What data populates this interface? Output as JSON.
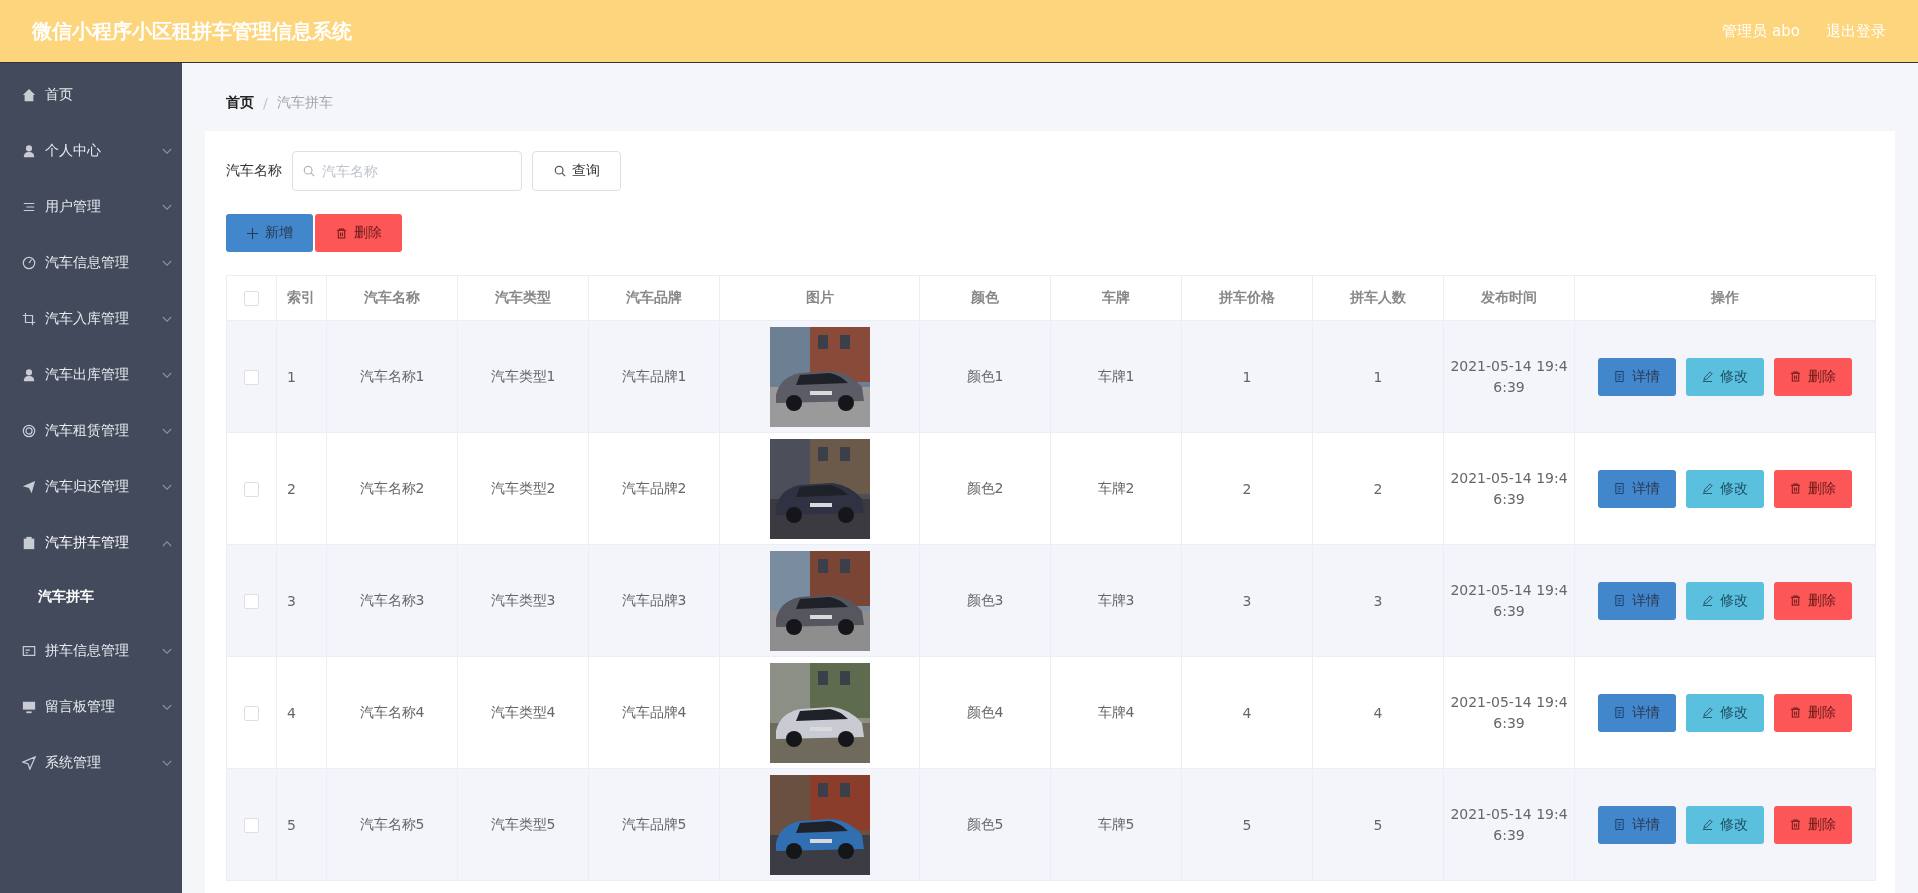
{
  "header": {
    "title": "微信小程序小区租拼车管理信息系统",
    "user": "管理员 abo",
    "logout": "退出登录"
  },
  "sidebar": {
    "items": [
      {
        "label": "首页"
      },
      {
        "label": "个人中心",
        "expanded": false
      },
      {
        "label": "用户管理",
        "expanded": false
      },
      {
        "label": "汽车信息管理",
        "expanded": false
      },
      {
        "label": "汽车入库管理",
        "expanded": false
      },
      {
        "label": "汽车出库管理",
        "expanded": false
      },
      {
        "label": "汽车租赁管理",
        "expanded": false
      },
      {
        "label": "汽车归还管理",
        "expanded": false
      },
      {
        "label": "汽车拼车管理",
        "expanded": true,
        "children": [
          {
            "label": "汽车拼车",
            "selected": true
          }
        ]
      },
      {
        "label": "拼车信息管理",
        "expanded": false
      },
      {
        "label": "留言板管理",
        "expanded": false
      },
      {
        "label": "系统管理",
        "expanded": false
      }
    ]
  },
  "breadcrumb": [
    {
      "label": "首页",
      "current": false
    },
    {
      "label": "汽车拼车",
      "current": true
    }
  ],
  "breadcrumb_separator": "/",
  "search": {
    "label": "汽车名称",
    "placeholder": "汽车名称",
    "button": "查询"
  },
  "toolbar": [
    {
      "label": "新增",
      "kind": "add"
    },
    {
      "label": "删除",
      "kind": "delete"
    }
  ],
  "table": {
    "header_checked": false,
    "columns": [
      "索引",
      "汽车名称",
      "汽车类型",
      "汽车品牌",
      "图片",
      "颜色",
      "车牌",
      "拼车价格",
      "拼车人数",
      "发布时间",
      "操作"
    ],
    "rows": [
      {
        "checked": false,
        "index": "1",
        "name": "汽车名称1",
        "type": "汽车类型1",
        "brand": "汽车品牌1",
        "car_color": "颜色1",
        "plate": "车牌1",
        "price": "1",
        "people": "1",
        "time": "2021-05-14 19:46:39",
        "actions": [
          {
            "label": "详情",
            "kind": "detail"
          },
          {
            "label": "修改",
            "kind": "edit"
          },
          {
            "label": "删除",
            "kind": "delete"
          }
        ]
      },
      {
        "checked": false,
        "index": "2",
        "name": "汽车名称2",
        "type": "汽车类型2",
        "brand": "汽车品牌2",
        "car_color": "颜色2",
        "plate": "车牌2",
        "price": "2",
        "people": "2",
        "time": "2021-05-14 19:46:39",
        "actions": [
          {
            "label": "详情",
            "kind": "detail"
          },
          {
            "label": "修改",
            "kind": "edit"
          },
          {
            "label": "删除",
            "kind": "delete"
          }
        ]
      },
      {
        "checked": false,
        "index": "3",
        "name": "汽车名称3",
        "type": "汽车类型3",
        "brand": "汽车品牌3",
        "car_color": "颜色3",
        "plate": "车牌3",
        "price": "3",
        "people": "3",
        "time": "2021-05-14 19:46:39",
        "actions": [
          {
            "label": "详情",
            "kind": "detail"
          },
          {
            "label": "修改",
            "kind": "edit"
          },
          {
            "label": "删除",
            "kind": "delete"
          }
        ]
      },
      {
        "checked": false,
        "index": "4",
        "name": "汽车名称4",
        "type": "汽车类型4",
        "brand": "汽车品牌4",
        "car_color": "颜色4",
        "plate": "车牌4",
        "price": "4",
        "people": "4",
        "time": "2021-05-14 19:46:39",
        "actions": [
          {
            "label": "详情",
            "kind": "detail"
          },
          {
            "label": "修改",
            "kind": "edit"
          },
          {
            "label": "删除",
            "kind": "delete"
          }
        ]
      },
      {
        "checked": false,
        "index": "5",
        "name": "汽车名称5",
        "type": "汽车类型5",
        "brand": "汽车品牌5",
        "car_color": "颜色5",
        "plate": "车牌5",
        "price": "5",
        "people": "5",
        "time": "2021-05-14 19:46:39",
        "actions": [
          {
            "label": "详情",
            "kind": "detail"
          },
          {
            "label": "修改",
            "kind": "edit"
          },
          {
            "label": "删除",
            "kind": "delete"
          }
        ]
      }
    ]
  }
}
